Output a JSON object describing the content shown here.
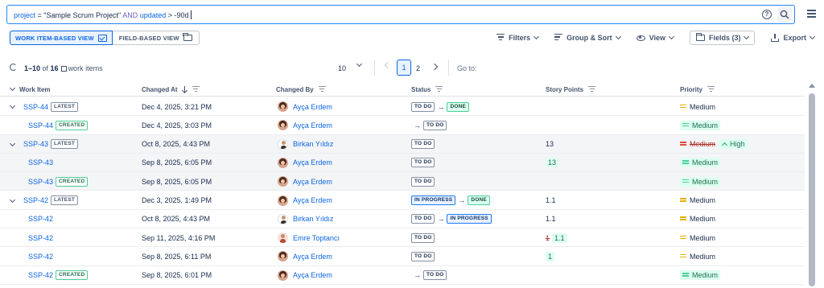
{
  "search": {
    "field1": "project",
    "op1": " = ",
    "value1": "\"Sample Scrum Project\"",
    "keyword": " AND ",
    "field2": "updated",
    "op2": " > ",
    "value2": "-90d"
  },
  "view_toggle": {
    "work_item_label": "WORK ITEM-BASED VIEW",
    "field_label": "FIELD-BASED VIEW"
  },
  "toolbar": {
    "filters": "Filters",
    "group_sort": "Group & Sort",
    "view": "View",
    "fields": "Fields (3)",
    "export": "Export"
  },
  "pager": {
    "range": "1–10",
    "of_text": " of ",
    "total": "16",
    "suffix": "work items",
    "per_page": "10",
    "page1": "1",
    "page2": "2",
    "goto": "Go to:"
  },
  "columns": {
    "work_item": "Work Item",
    "changed_at": "Changed At",
    "changed_by": "Changed By",
    "status": "Status",
    "story_points": "Story Points",
    "priority": "Priority"
  },
  "rows": [
    {
      "key": "SSP-44",
      "badge": "LATEST",
      "date": "Dec 4, 2025, 3:21 PM",
      "person": "Ayça Erdem",
      "status_from": "TO DO",
      "status_to": "DONE",
      "points": "",
      "prio": "Medium"
    },
    {
      "key": "SSP-44",
      "badge": "CREATED",
      "date": "Dec 4, 2025, 3:03 PM",
      "person": "Ayça Erdem",
      "status_to": "TO DO",
      "points": "",
      "prio": "Medium"
    },
    {
      "key": "SSP-43",
      "badge": "LATEST",
      "date": "Oct 8, 2025, 4:43 PM",
      "person": "Birkan Yıldız",
      "status_from": "TO DO",
      "points": "13",
      "prio_old": "Medium",
      "prio": "High"
    },
    {
      "key": "SSP-43",
      "date": "Sep 8, 2025, 6:05 PM",
      "person": "Ayça Erdem",
      "status_from": "TO DO",
      "points": "13",
      "prio": "Medium"
    },
    {
      "key": "SSP-43",
      "badge": "CREATED",
      "date": "Sep 8, 2025, 6:05 PM",
      "person": "Ayça Erdem",
      "status_from": "TO DO",
      "points": "",
      "prio": "Medium"
    },
    {
      "key": "SSP-42",
      "badge": "LATEST",
      "date": "Dec 3, 2025, 1:49 PM",
      "person": "Ayça Erdem",
      "status_from": "IN PROGRESS",
      "status_to": "DONE",
      "points": "1.1",
      "prio": "Medium"
    },
    {
      "key": "SSP-42",
      "date": "Oct 8, 2025, 4:43 PM",
      "person": "Birkan Yıldız",
      "status_from": "TO DO",
      "status_to": "IN PROGRESS",
      "points": "1.1",
      "prio": "Medium"
    },
    {
      "key": "SSP-42",
      "date": "Sep 11, 2025, 4:16 PM",
      "person": "Emre Toptancı",
      "status_from": "TO DO",
      "points_old": "1",
      "points": "1.1",
      "prio": "Medium"
    },
    {
      "key": "SSP-42",
      "date": "Sep 8, 2025, 6:11 PM",
      "person": "Ayça Erdem",
      "status_from": "TO DO",
      "points": "1",
      "prio": "Medium"
    },
    {
      "key": "SSP-42",
      "badge": "CREATED",
      "date": "Sep 8, 2025, 6:01 PM",
      "person": "Ayça Erdem",
      "status_to": "TO DO",
      "points": "",
      "prio": "Medium"
    }
  ],
  "colors": {
    "accent": "#0c66e4",
    "done": "#dcfff1",
    "medium": "#e2b203",
    "removed": "#ae2e24"
  }
}
